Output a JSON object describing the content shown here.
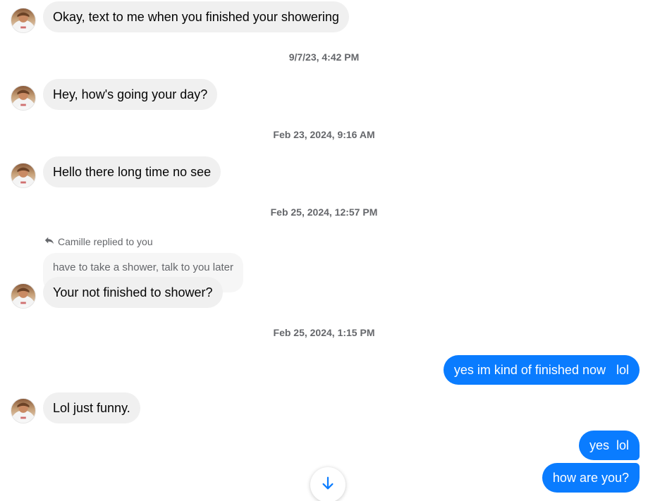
{
  "contact": {
    "name": "Camille",
    "avatar_icon": "contact-avatar"
  },
  "messages": [
    {
      "text": "Okay, text to me when you finished your showering"
    },
    {
      "text": "Hey, how's going your day?"
    },
    {
      "text": "Hello there long time no see"
    },
    {
      "text": "Your not finished to shower?"
    },
    {
      "text": "yes im kind of finished now   lol"
    },
    {
      "text": "Lol just funny."
    },
    {
      "text": "yes  lol"
    },
    {
      "text": "how are you?"
    }
  ],
  "timestamps": [
    "9/7/23, 4:42 PM",
    "Feb 23, 2024, 9:16 AM",
    "Feb 25, 2024, 12:57 PM",
    "Feb 25, 2024, 1:15 PM"
  ],
  "reply": {
    "note": "Camille replied to you",
    "quoted_text": "have to take a shower, talk to you later",
    "icon": "reply-arrow-icon"
  },
  "scroll_button": {
    "icon": "arrow-down-icon"
  },
  "colors": {
    "incoming_bubble": "#f0f0f0",
    "outgoing_bubble": "#0a7cff",
    "timestamp_text": "#65676b"
  }
}
